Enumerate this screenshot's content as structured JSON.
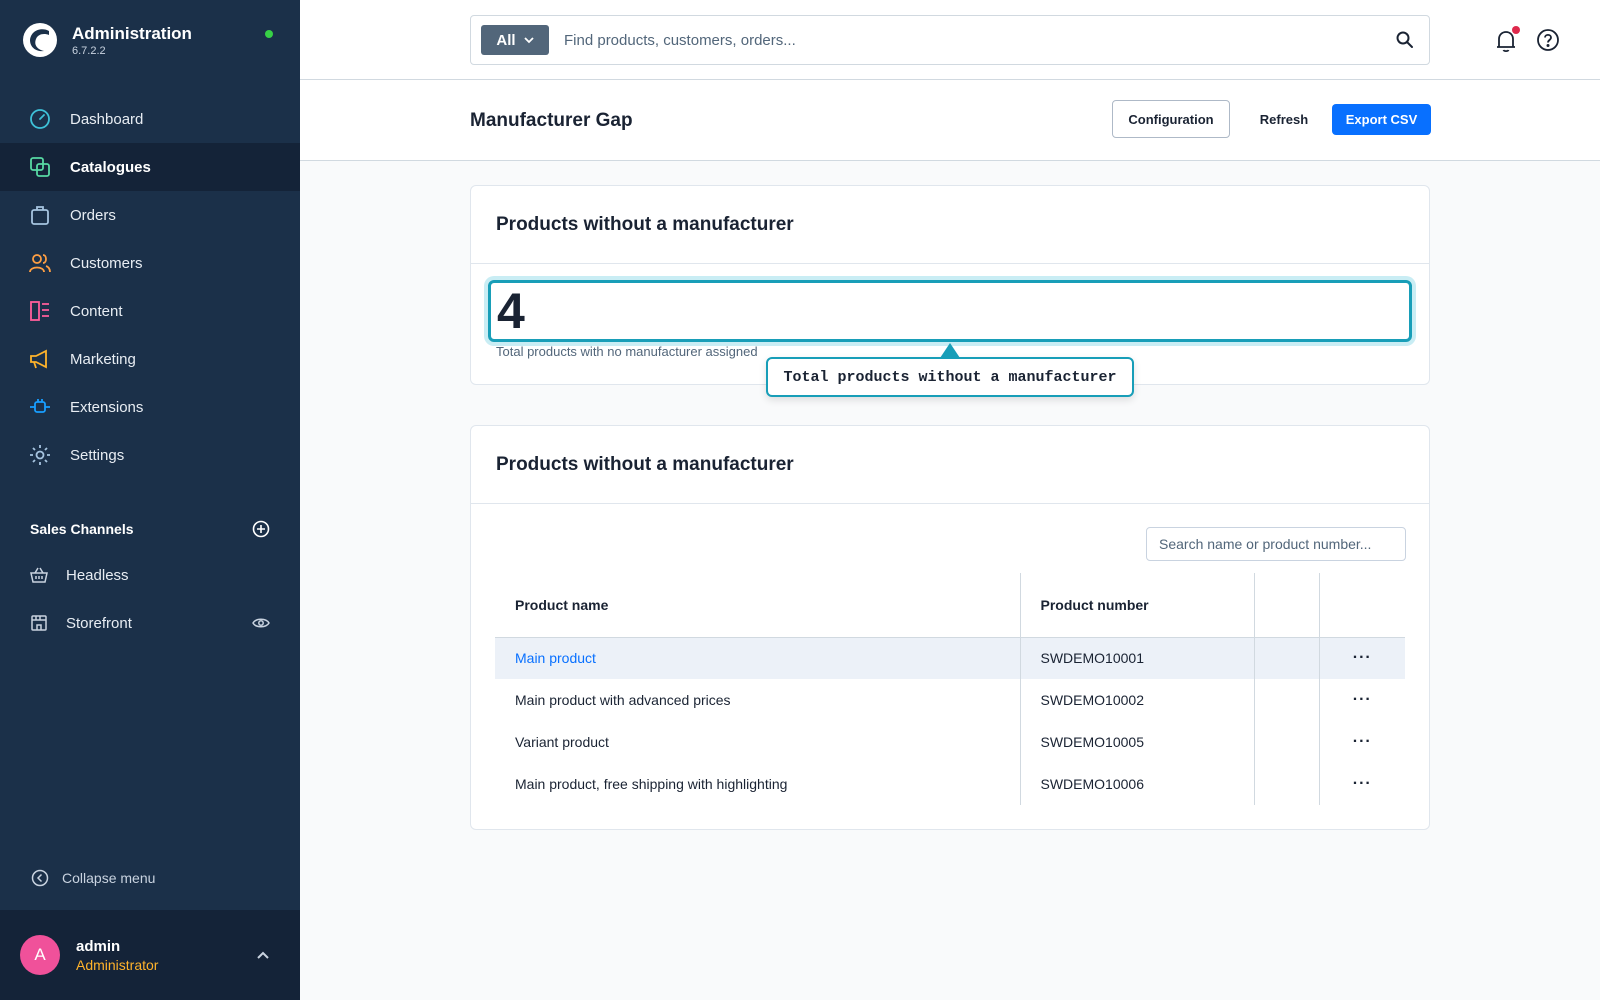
{
  "brand": {
    "title": "Administration",
    "version": "6.7.2.2"
  },
  "nav": {
    "items": [
      {
        "label": "Dashboard"
      },
      {
        "label": "Catalogues"
      },
      {
        "label": "Orders"
      },
      {
        "label": "Customers"
      },
      {
        "label": "Content"
      },
      {
        "label": "Marketing"
      },
      {
        "label": "Extensions"
      },
      {
        "label": "Settings"
      }
    ],
    "active": "Catalogues"
  },
  "sales_channels": {
    "title": "Sales Channels",
    "items": [
      {
        "label": "Headless"
      },
      {
        "label": "Storefront"
      }
    ]
  },
  "collapse_label": "Collapse menu",
  "user": {
    "initial": "A",
    "name": "admin",
    "role": "Administrator"
  },
  "search": {
    "type_label": "All",
    "placeholder": "Find products, customers, orders..."
  },
  "page": {
    "title": "Manufacturer Gap",
    "buttons": {
      "configuration": "Configuration",
      "refresh": "Refresh",
      "export": "Export CSV"
    }
  },
  "kpi_card": {
    "title": "Products without a manufacturer",
    "value": "4",
    "caption": "Total products with no manufacturer assigned",
    "tooltip": "Total products without a manufacturer"
  },
  "table_card": {
    "title": "Products without a manufacturer",
    "search_placeholder": "Search name or product number...",
    "columns": [
      "Product name",
      "Product number",
      "",
      ""
    ],
    "rows": [
      {
        "name": "Main product",
        "number": "SWDEMO10001",
        "actions": "···"
      },
      {
        "name": "Main product with advanced prices",
        "number": "SWDEMO10002",
        "actions": "···"
      },
      {
        "name": "Variant product",
        "number": "SWDEMO10005",
        "actions": "···"
      },
      {
        "name": "Main product, free shipping with highlighting",
        "number": "SWDEMO10006",
        "actions": "···"
      }
    ]
  },
  "colors": {
    "sidebar": "#1b3049",
    "sidebar_active": "#142338",
    "primary": "#0870ff",
    "highlight": "#189eb8",
    "role": "#ffb32b",
    "avatar": "#f0519a"
  }
}
